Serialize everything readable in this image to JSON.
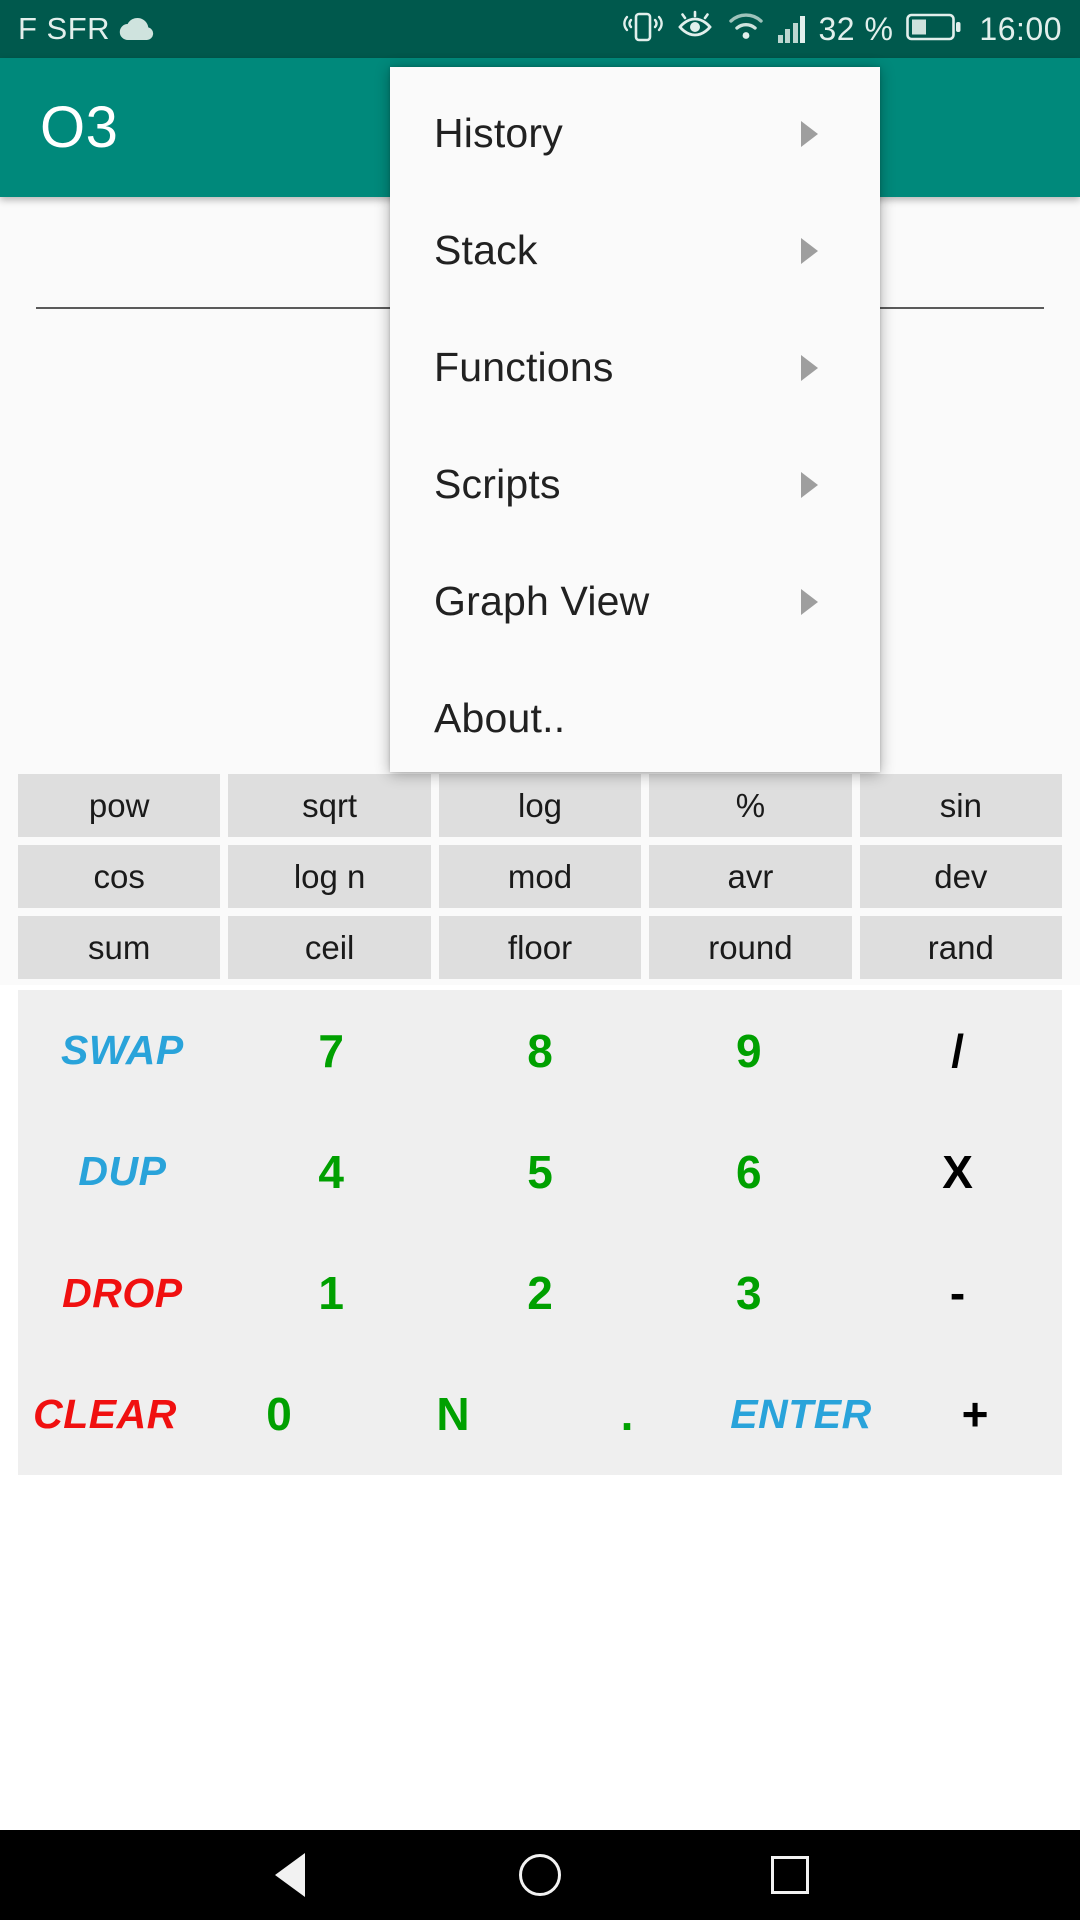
{
  "status_bar": {
    "carrier": "F SFR",
    "cloud_icon": "cloud-icon",
    "vibrate_icon": "vibrate-icon",
    "eye_icon": "eye-care-icon",
    "wifi_icon": "wifi-icon",
    "signal_icon": "signal-bars-icon",
    "battery_percent": "32 %",
    "battery_icon": "battery-icon",
    "time": "16:00",
    "background_color": "#00594d"
  },
  "app_bar": {
    "title": "O3",
    "background_color": "#00897b",
    "text_color": "#ffffff"
  },
  "display": {
    "entry_value": ""
  },
  "menu": {
    "background_color": "#fafafa",
    "items": [
      {
        "label": "History",
        "has_submenu": true,
        "arrow_icon": "chevron-right-icon"
      },
      {
        "label": "Stack",
        "has_submenu": true,
        "arrow_icon": "chevron-right-icon"
      },
      {
        "label": "Functions",
        "has_submenu": true,
        "arrow_icon": "chevron-right-icon"
      },
      {
        "label": "Scripts",
        "has_submenu": true,
        "arrow_icon": "chevron-right-icon"
      },
      {
        "label": "Graph View",
        "has_submenu": true,
        "arrow_icon": "chevron-right-icon"
      },
      {
        "label": "About..",
        "has_submenu": false,
        "arrow_icon": ""
      }
    ]
  },
  "function_pad": {
    "key_color": "#dedede",
    "rows": [
      [
        "pow",
        "sqrt",
        "log",
        "%",
        "sin"
      ],
      [
        "cos",
        "log n",
        "mod",
        "avr",
        "dev"
      ],
      [
        "sum",
        "ceil",
        "floor",
        "round",
        "rand"
      ]
    ]
  },
  "keypad": {
    "background_color": "#efefef",
    "colors": {
      "number": "#00a000",
      "command_blue": "#29a3da",
      "command_red": "#f01010",
      "operator": "#000000"
    },
    "rows": [
      [
        {
          "label": "SWAP",
          "kind": "cmd-blue"
        },
        {
          "label": "7",
          "kind": "num"
        },
        {
          "label": "8",
          "kind": "num"
        },
        {
          "label": "9",
          "kind": "num"
        },
        {
          "label": "/",
          "kind": "op"
        }
      ],
      [
        {
          "label": "DUP",
          "kind": "cmd-blue"
        },
        {
          "label": "4",
          "kind": "num"
        },
        {
          "label": "5",
          "kind": "num"
        },
        {
          "label": "6",
          "kind": "num"
        },
        {
          "label": "X",
          "kind": "op"
        }
      ],
      [
        {
          "label": "DROP",
          "kind": "cmd-red"
        },
        {
          "label": "1",
          "kind": "num"
        },
        {
          "label": "2",
          "kind": "num"
        },
        {
          "label": "3",
          "kind": "num"
        },
        {
          "label": "-",
          "kind": "op"
        }
      ],
      [
        {
          "label": "CLEAR",
          "kind": "cmd-red"
        },
        {
          "label": "0",
          "kind": "num"
        },
        {
          "label": "N",
          "kind": "num"
        },
        {
          "label": ".",
          "kind": "num"
        },
        {
          "label": "ENTER",
          "kind": "cmd-blue"
        },
        {
          "label": "+",
          "kind": "op"
        }
      ]
    ]
  },
  "nav_bar": {
    "back_icon": "back-triangle-icon",
    "home_icon": "home-circle-icon",
    "recents_icon": "recents-square-icon"
  }
}
